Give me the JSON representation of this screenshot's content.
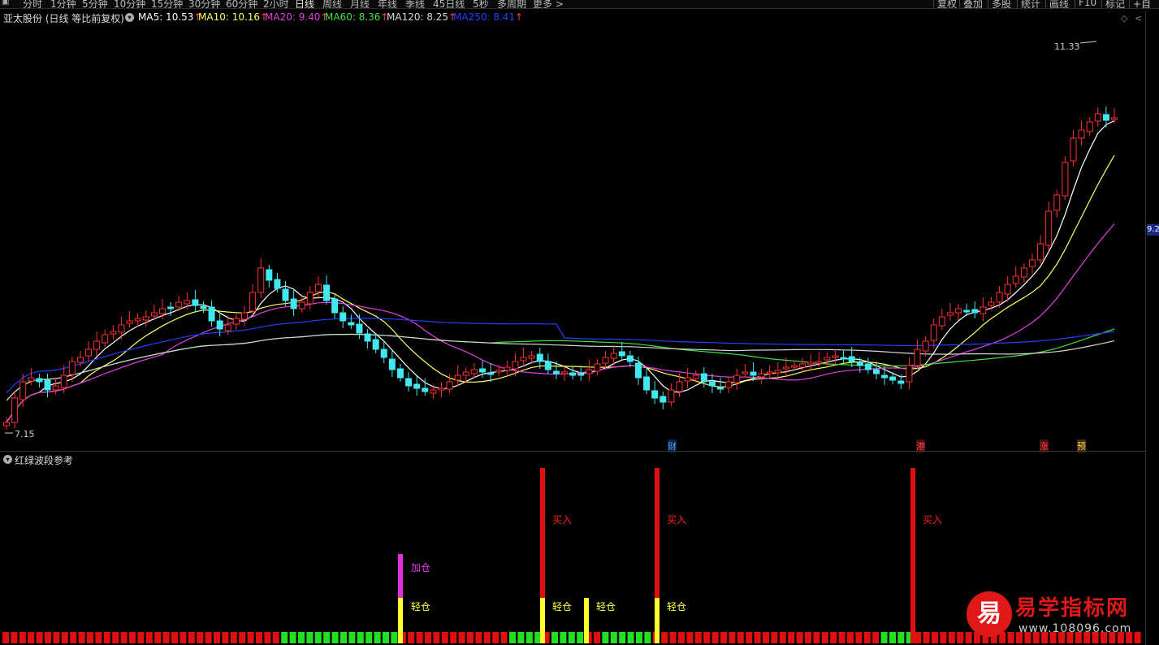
{
  "toolbar": {
    "tabs": [
      "分时",
      "1分钟",
      "5分钟",
      "10分钟",
      "15分钟",
      "30分钟",
      "60分钟",
      "2小时",
      "日线",
      "周线",
      "月线",
      "年线",
      "季线",
      "45日线",
      "5秒",
      "多周期",
      "更多 >"
    ],
    "active_tab": "日线",
    "right_buttons": [
      "复权",
      "叠加",
      "多股",
      "统计",
      "画线",
      "F10",
      "标记",
      "+自选"
    ]
  },
  "stock": {
    "title": "亚太股份 (日线 等比前复权)",
    "ma": [
      {
        "label": "MA5: 10.53",
        "color": "#ffffff"
      },
      {
        "label": "MA10: 10.16",
        "color": "#ffff60"
      },
      {
        "label": "MA20: 9.40",
        "color": "#e040e0"
      },
      {
        "label": "MA60: 8.36",
        "color": "#40e040"
      },
      {
        "label": "MA120: 8.25",
        "color": "#d8d8d8"
      },
      {
        "label": "MA250: 8.41",
        "color": "#2040ff"
      }
    ],
    "arrow": "↑",
    "high_label": "11.33",
    "low_label": "7.15",
    "axis_tag": "9.2"
  },
  "markers": [
    {
      "text": "财",
      "color": "#4aa0ff"
    },
    {
      "text": "港",
      "color": "#ff4040"
    },
    {
      "text": "涨",
      "color": "#ff4040"
    },
    {
      "text": "预",
      "color": "#ffd040"
    }
  ],
  "indicator": {
    "title": "红绿波段参考",
    "signals": [
      {
        "label": "加仓",
        "color": "#e040e0"
      },
      {
        "label": "轻仓",
        "color": "#ffff40"
      },
      {
        "label": "买入",
        "color": "#ff2020"
      }
    ]
  },
  "logo": {
    "glyph": "易",
    "name": "易学指标网",
    "url": "www.108096.com"
  }
}
